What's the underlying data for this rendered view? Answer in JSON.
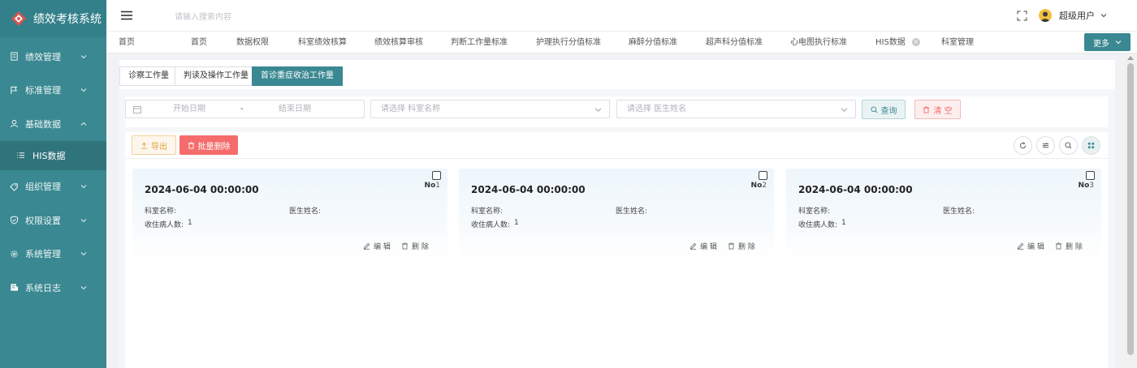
{
  "app": {
    "title": "绩效考核系统",
    "accent": "#3a8891"
  },
  "sidebar": {
    "items": [
      {
        "label": "绩效管理",
        "icon": "document-icon"
      },
      {
        "label": "标准管理",
        "icon": "flag-icon"
      },
      {
        "label": "基础数据",
        "icon": "user-icon"
      },
      {
        "label": "HIS数据",
        "icon": "list-icon"
      },
      {
        "label": "组织管理",
        "icon": "tag-icon"
      },
      {
        "label": "权限设置",
        "icon": "shield-icon"
      },
      {
        "label": "系统管理",
        "icon": "gear-icon"
      },
      {
        "label": "系统日志",
        "icon": "log-icon"
      }
    ]
  },
  "header": {
    "search_placeholder": "请输入搜索内容",
    "user": "超级用户"
  },
  "tabs": [
    "首页",
    "首页",
    "数据权限",
    "科室绩效核算",
    "绩效核算审核",
    "判断工作量标准",
    "护理执行分值标准",
    "麻醉分值标准",
    "超声科分值标准",
    "心电图执行标准",
    "HIS数据",
    "科室管理"
  ],
  "more_label": "更多",
  "subtabs": [
    "诊察工作量",
    "判读及操作工作量",
    "首诊重症收治工作量"
  ],
  "filter": {
    "start_date": "开始日期",
    "sep": "-",
    "end_date": "结束日期",
    "dept_placeholder": "请选择 科室名称",
    "doctor_placeholder": "请选择 医生姓名",
    "query": "查询",
    "clear": "清 空"
  },
  "toolbar": {
    "export": "导出",
    "batch_delete": "批量删除"
  },
  "cards": [
    {
      "date": "2024-06-04 00:00:00",
      "no_label": "No",
      "no": "1",
      "dept_label": "科室名称:",
      "doctor_label": "医生姓名:",
      "patients_label": "收住病人数:",
      "patients": "1",
      "edit": "编 辑",
      "delete": "删 除"
    },
    {
      "date": "2024-06-04 00:00:00",
      "no_label": "No",
      "no": "2",
      "dept_label": "科室名称:",
      "doctor_label": "医生姓名:",
      "patients_label": "收住病人数:",
      "patients": "1",
      "edit": "编 辑",
      "delete": "删 除"
    },
    {
      "date": "2024-06-04 00:00:00",
      "no_label": "No",
      "no": "3",
      "dept_label": "科室名称:",
      "doctor_label": "医生姓名:",
      "patients_label": "收住病人数:",
      "patients": "1",
      "edit": "编 辑",
      "delete": "删 除"
    }
  ]
}
